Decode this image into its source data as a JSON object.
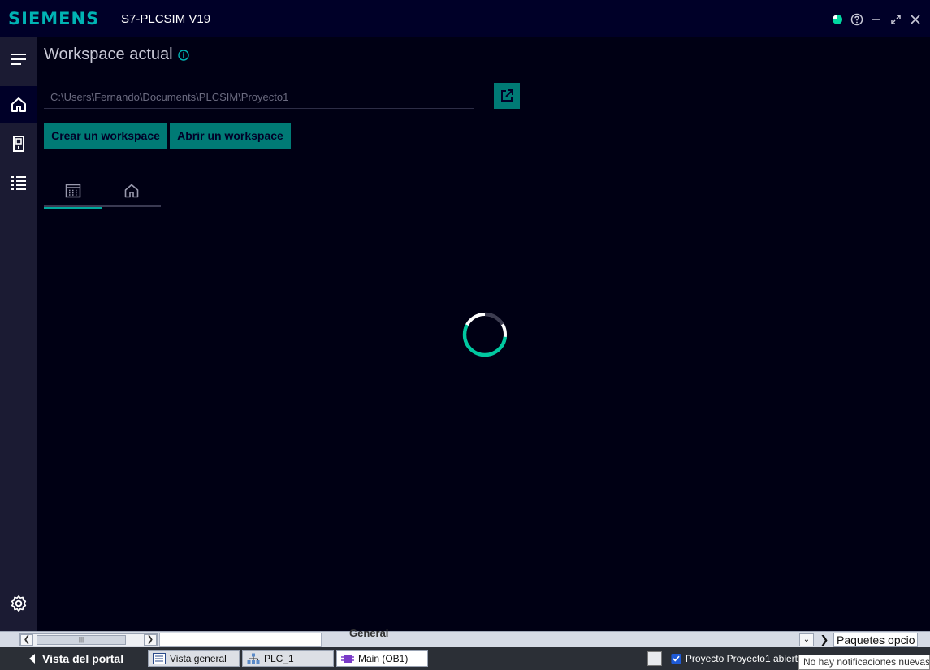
{
  "window": {
    "brand": "SIEMENS",
    "title": "S7-PLCSIM V19",
    "controls": [
      "status-icon",
      "help-icon",
      "minimize-icon",
      "maximize-icon",
      "close-icon"
    ]
  },
  "rail": {
    "items": [
      {
        "name": "menu",
        "icon": "hamburger-icon"
      },
      {
        "name": "home",
        "icon": "home-icon",
        "active": true
      },
      {
        "name": "device",
        "icon": "device-icon"
      },
      {
        "name": "list",
        "icon": "list-icon"
      },
      {
        "name": "settings",
        "icon": "gear-icon"
      }
    ]
  },
  "workspace": {
    "title": "Workspace actual",
    "path_placeholder": "C:\\Users\\Fernando\\Documents\\PLCSIM\\Proyecto1",
    "create_label": "Crear un workspace",
    "open_label": "Abrir un workspace",
    "tabs": [
      {
        "icon": "grid-icon",
        "active": true
      },
      {
        "icon": "home-icon",
        "active": false
      }
    ]
  },
  "tia": {
    "general_tab": "General",
    "paquetes_label": "Paquetes opcio",
    "portal_view_label": "Vista del portal",
    "tasks": [
      {
        "label": "Vista general",
        "icon": "overview-icon"
      },
      {
        "label": "PLC_1",
        "icon": "network-icon"
      },
      {
        "label": "Main (OB1)",
        "icon": "block-icon",
        "active": true
      }
    ],
    "status_text": "Proyecto Proyecto1 abiert",
    "notification": "No hay notificaciones nuevas"
  },
  "colors": {
    "accent": "#00b3b3",
    "button": "#007a75",
    "background": "#000014",
    "titlebar": "#000028",
    "rail": "#1b1b33"
  }
}
